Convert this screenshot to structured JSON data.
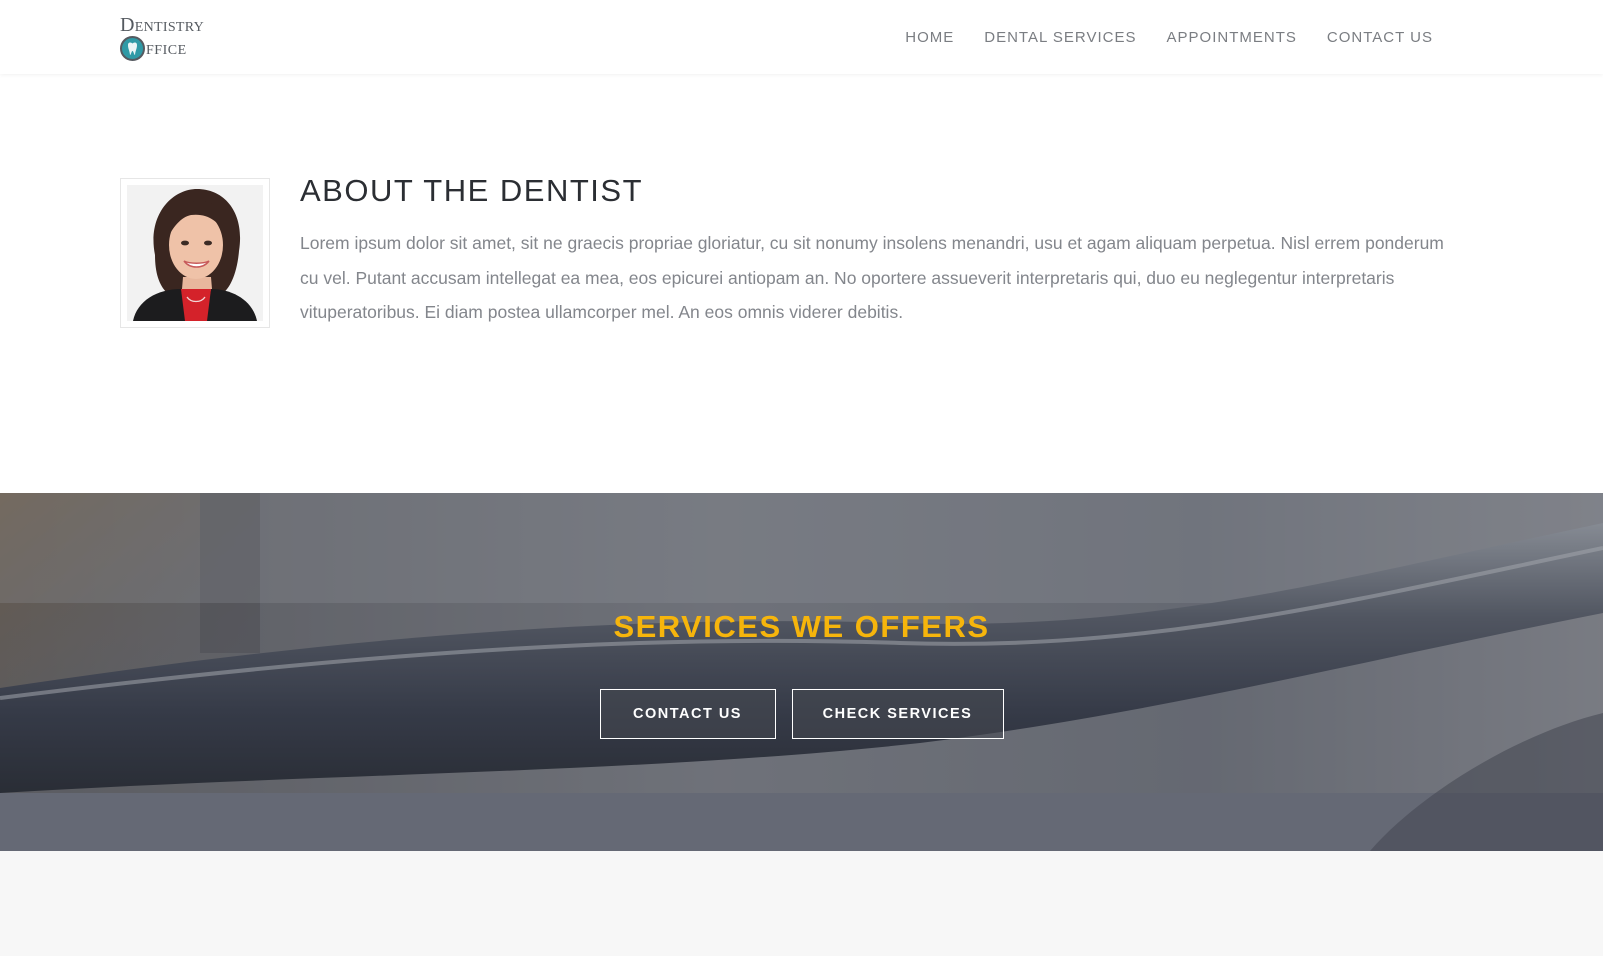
{
  "header": {
    "logo": {
      "line1": "Dentistry",
      "line2_rest": "ffice",
      "brand_color": "#2f9aa6"
    },
    "nav": [
      {
        "label": "HOME"
      },
      {
        "label": "DENTAL SERVICES"
      },
      {
        "label": "APPOINTMENTS"
      },
      {
        "label": "CONTACT US"
      }
    ]
  },
  "about": {
    "title": "ABOUT THE DENTIST",
    "text": "Lorem ipsum dolor sit amet, sit ne graecis propriae gloriatur, cu sit nonumy insolens menandri, usu et agam aliquam perpetua. Nisl errem ponderum cu vel. Putant accusam intellegat ea mea, eos epicurei antiopam an. No oportere assueverit interpretaris qui, duo eu neglegentur interpretaris vituperatoribus. Ei diam postea ullamcorper mel. An eos omnis viderer debitis."
  },
  "banner": {
    "title": "SERVICES WE OFFERS",
    "accent_color": "#f6b50c",
    "buttons": [
      {
        "label": "CONTACT US"
      },
      {
        "label": "CHECK SERVICES"
      }
    ]
  }
}
